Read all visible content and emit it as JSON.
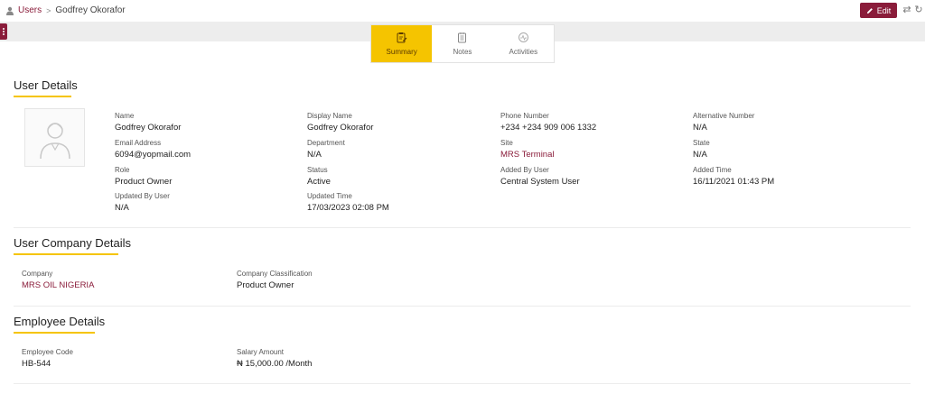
{
  "breadcrumb": {
    "root": "Users",
    "separator": ">",
    "current": "Godfrey Okorafor"
  },
  "toolbar": {
    "edit_label": "Edit"
  },
  "tabs": [
    {
      "label": "Summary",
      "icon": "clipboard-edit-icon",
      "active": true
    },
    {
      "label": "Notes",
      "icon": "notes-icon",
      "active": false
    },
    {
      "label": "Activities",
      "icon": "activity-icon",
      "active": false
    }
  ],
  "user_details": {
    "title": "User Details",
    "fields": {
      "name": {
        "label": "Name",
        "value": "Godfrey Okorafor"
      },
      "display_name": {
        "label": "Display Name",
        "value": "Godfrey Okorafor"
      },
      "phone": {
        "label": "Phone Number",
        "value": "+234 +234 909 006 1332"
      },
      "alt_phone": {
        "label": "Alternative Number",
        "value": "N/A"
      },
      "email": {
        "label": "Email Address",
        "value": "6094@yopmail.com"
      },
      "department": {
        "label": "Department",
        "value": "N/A"
      },
      "site": {
        "label": "Site",
        "value": "MRS Terminal"
      },
      "state": {
        "label": "State",
        "value": "N/A"
      },
      "role": {
        "label": "Role",
        "value": "Product Owner"
      },
      "status": {
        "label": "Status",
        "value": "Active"
      },
      "added_by": {
        "label": "Added By User",
        "value": "Central System User"
      },
      "added_time": {
        "label": "Added Time",
        "value": "16/11/2021 01:43 PM"
      },
      "updated_by": {
        "label": "Updated By User",
        "value": "N/A"
      },
      "updated_time": {
        "label": "Updated Time",
        "value": "17/03/2023 02:08 PM"
      }
    }
  },
  "company_details": {
    "title": "User Company Details",
    "fields": {
      "company": {
        "label": "Company",
        "value": "MRS OIL NIGERIA"
      },
      "classification": {
        "label": "Company Classification",
        "value": "Product Owner"
      }
    }
  },
  "employee_details": {
    "title": "Employee Details",
    "fields": {
      "code": {
        "label": "Employee Code",
        "value": "HB-544"
      },
      "salary": {
        "label": "Salary Amount",
        "value": "₦ 15,000.00 /Month"
      }
    }
  },
  "colors": {
    "brand": "#8a1c3a",
    "accent": "#f5c400"
  }
}
